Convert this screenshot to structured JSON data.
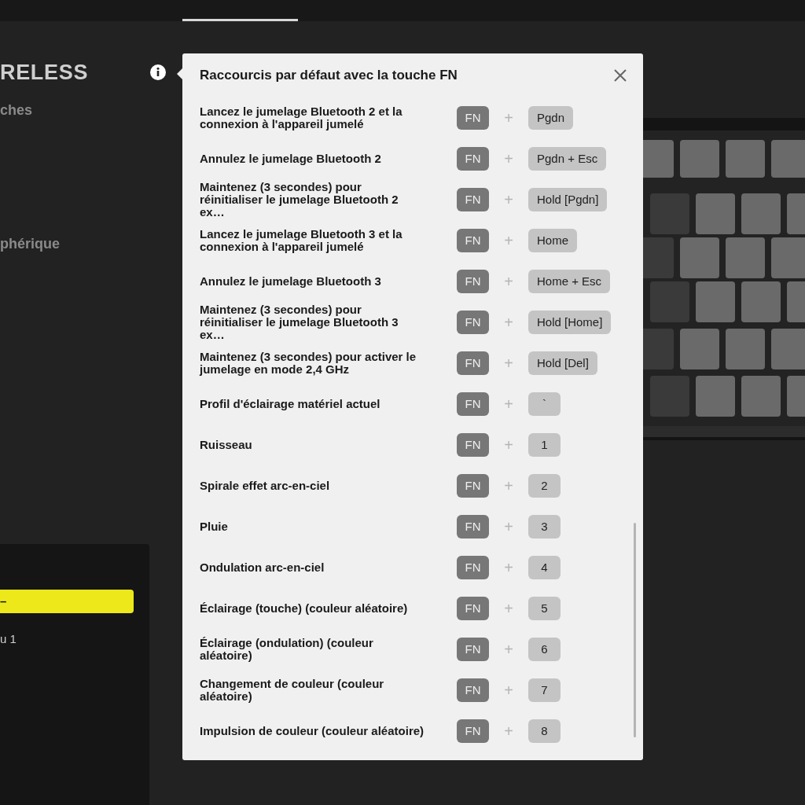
{
  "device": {
    "name": "RELESS",
    "menu": [
      {
        "label": "ches"
      },
      {
        "label": "phérique"
      }
    ]
  },
  "panel": {
    "items": [
      {
        "label": "–",
        "selected": true
      },
      {
        "label": "u 1",
        "selected": false
      }
    ]
  },
  "dialog": {
    "title": "Raccourcis par défaut avec la touche FN",
    "rows": [
      {
        "action": "Lancez le jumelage Bluetooth 2 et la connexion à l'appareil jumelé",
        "modifier": "FN",
        "separator": "+",
        "key": "Pgdn"
      },
      {
        "action": "Annulez le jumelage Bluetooth 2",
        "modifier": "FN",
        "separator": "+",
        "key": "Pgdn + Esc"
      },
      {
        "action": "Maintenez (3 secondes) pour réinitialiser le jumelage Bluetooth 2 ex…",
        "modifier": "FN",
        "separator": "+",
        "key": "Hold [Pgdn]"
      },
      {
        "action": "Lancez le jumelage Bluetooth 3 et la connexion à l'appareil jumelé",
        "modifier": "FN",
        "separator": "+",
        "key": "Home"
      },
      {
        "action": "Annulez le jumelage Bluetooth 3",
        "modifier": "FN",
        "separator": "+",
        "key": "Home + Esc"
      },
      {
        "action": "Maintenez (3 secondes) pour réinitialiser le jumelage Bluetooth 3 ex…",
        "modifier": "FN",
        "separator": "+",
        "key": "Hold [Home]"
      },
      {
        "action": "Maintenez (3 secondes) pour activer le jumelage en mode 2,4 GHz",
        "modifier": "FN",
        "separator": "+",
        "key": "Hold [Del]"
      },
      {
        "action": "Profil d'éclairage matériel actuel",
        "modifier": "FN",
        "separator": "+",
        "key": "`"
      },
      {
        "action": "Ruisseau",
        "modifier": "FN",
        "separator": "+",
        "key": "1"
      },
      {
        "action": "Spirale effet arc-en-ciel",
        "modifier": "FN",
        "separator": "+",
        "key": "2"
      },
      {
        "action": "Pluie",
        "modifier": "FN",
        "separator": "+",
        "key": "3"
      },
      {
        "action": "Ondulation arc-en-ciel",
        "modifier": "FN",
        "separator": "+",
        "key": "4"
      },
      {
        "action": "Éclairage (touche) (couleur aléatoire)",
        "modifier": "FN",
        "separator": "+",
        "key": "5"
      },
      {
        "action": "Éclairage (ondulation) (couleur aléatoire)",
        "modifier": "FN",
        "separator": "+",
        "key": "6"
      },
      {
        "action": "Changement de couleur (couleur aléatoire)",
        "modifier": "FN",
        "separator": "+",
        "key": "7"
      },
      {
        "action": "Impulsion de couleur (couleur aléatoire)",
        "modifier": "FN",
        "separator": "+",
        "key": "8"
      }
    ]
  }
}
